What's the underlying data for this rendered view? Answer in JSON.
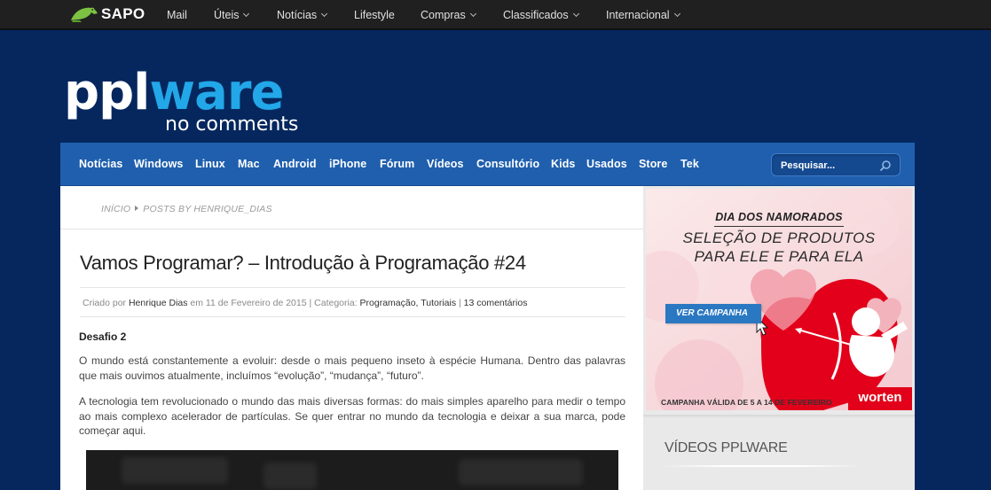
{
  "sapo": {
    "brand": "SAPO",
    "nav": [
      {
        "label": "Mail",
        "dropdown": false
      },
      {
        "label": "Úteis",
        "dropdown": true
      },
      {
        "label": "Notícias",
        "dropdown": true
      },
      {
        "label": "Lifestyle",
        "dropdown": false
      },
      {
        "label": "Compras",
        "dropdown": true
      },
      {
        "label": "Classificados",
        "dropdown": true
      },
      {
        "label": "Internacional",
        "dropdown": true
      }
    ]
  },
  "logo": {
    "main": "pplware",
    "tagline": "no comments"
  },
  "main_nav": {
    "items": [
      "Notícias",
      "Windows",
      "Linux",
      "Mac",
      "Android",
      "iPhone",
      "Fórum",
      "Vídeos",
      "Consultório",
      "Kids",
      "Usados",
      "Store",
      "Tek"
    ],
    "search_placeholder": "Pesquisar..."
  },
  "breadcrumb": {
    "home": "Início",
    "current": "Posts by henrique_dias"
  },
  "post": {
    "title": "Vamos Programar? – Introdução à Programação #24",
    "meta": {
      "created_by_label": "Criado por",
      "author": "Henrique Dias",
      "date_text": "em 11 de Fevereiro de 2015",
      "sep": "|",
      "category_label": "Categoria:",
      "category1": "Programação",
      "category2": "Tutoriais",
      "comments": "13 comentários"
    },
    "subheading": "Desafio 2",
    "paragraphs": [
      "O mundo está constantemente a evoluir: desde o mais pequeno inseto à espécie Humana. Dentro das palavras que mais ouvimos atualmente, incluímos “evolução”, “mudança”, “futuro”.",
      "A tecnologia tem revolucionado o mundo das mais diversas formas: do mais simples aparelho para medir o tempo ao mais complexo acelerador de partículas. Se quer entrar no mundo da tecnologia e deixar a sua marca, pode começar aqui."
    ]
  },
  "ad": {
    "title": "DIA DOS NAMORADOS",
    "line1": "SELEÇÃO DE PRODUTOS",
    "line2": "PARA ELE E PARA ELA",
    "button": "VER CAMPANHA",
    "footer": "CAMPANHA VÁLIDA DE 5 A 14 DE FEVEREIRO",
    "brand": "worten"
  },
  "sidebar": {
    "videos_title": "VÍDEOS PPLWARE"
  }
}
